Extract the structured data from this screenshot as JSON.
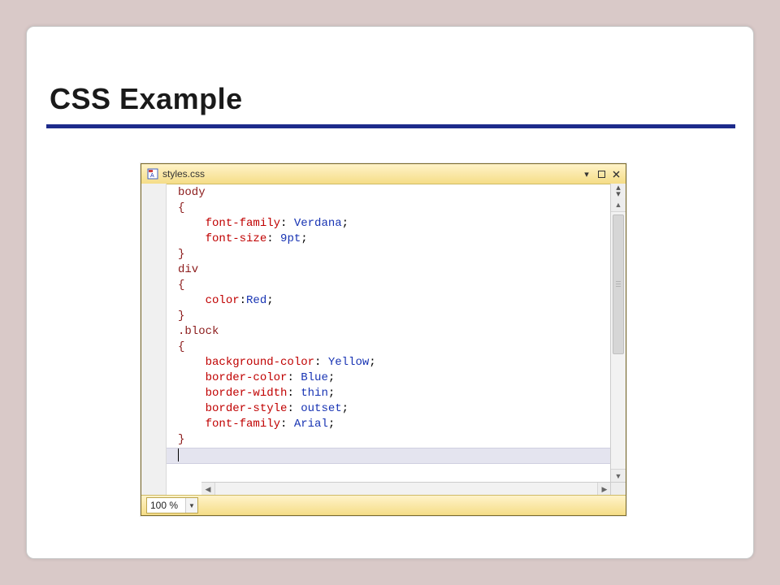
{
  "slide": {
    "title": "CSS Example"
  },
  "editor": {
    "filename": "styles.css",
    "zoom": "100 %",
    "code": {
      "rules": [
        {
          "selector": "body",
          "declarations": [
            {
              "prop": "font-family",
              "sep": ": ",
              "value": "Verdana"
            },
            {
              "prop": "font-size",
              "sep": ": ",
              "value": "9pt"
            }
          ]
        },
        {
          "selector": "div",
          "declarations": [
            {
              "prop": "color",
              "sep": ":",
              "value": "Red"
            }
          ]
        },
        {
          "selector": ".block",
          "declarations": [
            {
              "prop": "background-color",
              "sep": ": ",
              "value": "Yellow"
            },
            {
              "prop": "border-color",
              "sep": ": ",
              "value": "Blue"
            },
            {
              "prop": "border-width",
              "sep": ": ",
              "value": "thin"
            },
            {
              "prop": "border-style",
              "sep": ": ",
              "value": "outset"
            },
            {
              "prop": "font-family",
              "sep": ": ",
              "value": "Arial"
            }
          ]
        }
      ]
    }
  }
}
